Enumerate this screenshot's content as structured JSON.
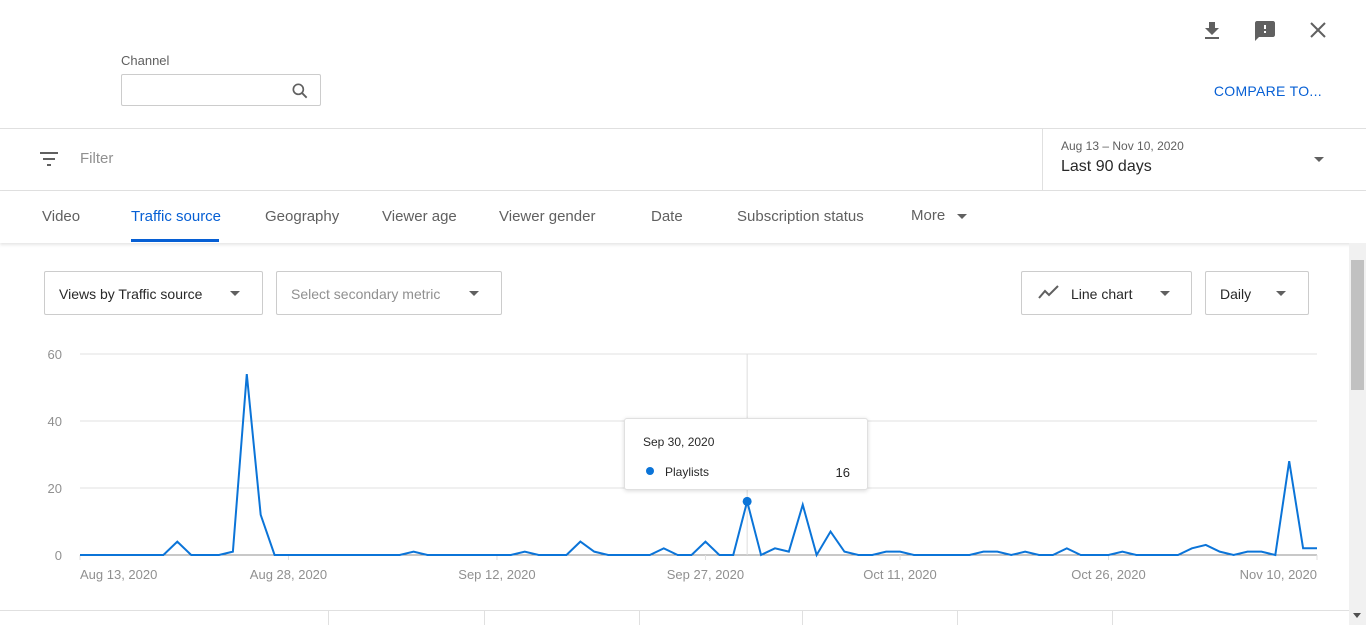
{
  "header": {
    "channel_label": "Channel",
    "channel_value": "",
    "compare_label": "COMPARE TO...",
    "icons": [
      "download-icon",
      "feedback-icon",
      "close-icon",
      "search-icon"
    ]
  },
  "filter": {
    "placeholder": "Filter",
    "date_range": "Aug 13 – Nov 10, 2020",
    "period": "Last 90 days"
  },
  "tabs": [
    {
      "label": "Video"
    },
    {
      "label": "Traffic source",
      "active": true
    },
    {
      "label": "Geography"
    },
    {
      "label": "Viewer age"
    },
    {
      "label": "Viewer gender"
    },
    {
      "label": "Date"
    },
    {
      "label": "Subscription status"
    },
    {
      "label": "More"
    }
  ],
  "controls": {
    "metric": "Views by Traffic source",
    "secondary_placeholder": "Select secondary metric",
    "chart_type": "Line chart",
    "interval": "Daily"
  },
  "tooltip": {
    "date": "Sep 30, 2020",
    "series": "Playlists",
    "value": "16"
  },
  "accent": "#065fd4",
  "chart_data": {
    "type": "line",
    "ylim": [
      0,
      60
    ],
    "y_ticks": [
      "0",
      "20",
      "40",
      "60"
    ],
    "x_tick_labels": [
      "Aug 13, 2020",
      "Aug 28, 2020",
      "Sep 12, 2020",
      "Sep 27, 2020",
      "Oct 11, 2020",
      "Oct 26, 2020",
      "Nov 10, 2020"
    ],
    "x_tick_dates": [
      "2020-08-13",
      "2020-08-28",
      "2020-09-12",
      "2020-09-27",
      "2020-10-11",
      "2020-10-26",
      "2020-11-10"
    ],
    "grid": true,
    "highlight": {
      "date": "2020-09-30",
      "value": 16
    },
    "color": "#0b74d8",
    "x": [
      "2020-08-13",
      "2020-08-14",
      "2020-08-15",
      "2020-08-16",
      "2020-08-17",
      "2020-08-18",
      "2020-08-19",
      "2020-08-20",
      "2020-08-21",
      "2020-08-22",
      "2020-08-23",
      "2020-08-24",
      "2020-08-25",
      "2020-08-26",
      "2020-08-27",
      "2020-08-28",
      "2020-08-29",
      "2020-08-30",
      "2020-08-31",
      "2020-09-01",
      "2020-09-02",
      "2020-09-03",
      "2020-09-04",
      "2020-09-05",
      "2020-09-06",
      "2020-09-07",
      "2020-09-08",
      "2020-09-09",
      "2020-09-10",
      "2020-09-11",
      "2020-09-12",
      "2020-09-13",
      "2020-09-14",
      "2020-09-15",
      "2020-09-16",
      "2020-09-17",
      "2020-09-18",
      "2020-09-19",
      "2020-09-20",
      "2020-09-21",
      "2020-09-22",
      "2020-09-23",
      "2020-09-24",
      "2020-09-25",
      "2020-09-26",
      "2020-09-27",
      "2020-09-28",
      "2020-09-29",
      "2020-09-30",
      "2020-10-01",
      "2020-10-02",
      "2020-10-03",
      "2020-10-04",
      "2020-10-05",
      "2020-10-06",
      "2020-10-07",
      "2020-10-08",
      "2020-10-09",
      "2020-10-10",
      "2020-10-11",
      "2020-10-12",
      "2020-10-13",
      "2020-10-14",
      "2020-10-15",
      "2020-10-16",
      "2020-10-17",
      "2020-10-18",
      "2020-10-19",
      "2020-10-20",
      "2020-10-21",
      "2020-10-22",
      "2020-10-23",
      "2020-10-24",
      "2020-10-25",
      "2020-10-26",
      "2020-10-27",
      "2020-10-28",
      "2020-10-29",
      "2020-10-30",
      "2020-10-31",
      "2020-11-01",
      "2020-11-02",
      "2020-11-03",
      "2020-11-04",
      "2020-11-05",
      "2020-11-06",
      "2020-11-07",
      "2020-11-08",
      "2020-11-09",
      "2020-11-10"
    ],
    "series": [
      {
        "name": "Playlists",
        "values": [
          0,
          0,
          0,
          0,
          0,
          0,
          0,
          4,
          0,
          0,
          0,
          1,
          54,
          12,
          0,
          0,
          0,
          0,
          0,
          0,
          0,
          0,
          0,
          0,
          1,
          0,
          0,
          0,
          0,
          0,
          0,
          0,
          1,
          0,
          0,
          0,
          4,
          1,
          0,
          0,
          0,
          0,
          2,
          0,
          0,
          4,
          0,
          0,
          16,
          0,
          2,
          1,
          15,
          0,
          7,
          1,
          0,
          0,
          1,
          1,
          0,
          0,
          0,
          0,
          0,
          1,
          1,
          0,
          1,
          0,
          0,
          2,
          0,
          0,
          0,
          1,
          0,
          0,
          0,
          0,
          2,
          3,
          1,
          0,
          1,
          1,
          0,
          28,
          2,
          2
        ]
      }
    ]
  }
}
